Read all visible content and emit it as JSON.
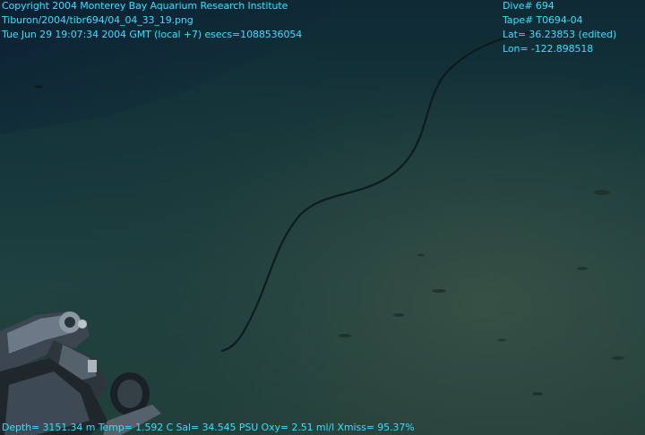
{
  "overlay": {
    "top_left": {
      "copyright": "Copyright 2004 Monterey Bay Aquarium Research Institute",
      "file": "Tiburon/2004/tibr694/04_04_33_19.png",
      "time": "Tue Jun 29 19:07:34 2004 GMT (local +7)  esecs=1088536054"
    },
    "top_right": {
      "dive": "Dive# 694",
      "tape": "Tape# T0694-04",
      "lat": "Lat= 36.23853 (edited)",
      "lon": "Lon= -122.898518"
    },
    "bottom": {
      "sensors": "Depth= 3151.34 m  Temp= 1.592 C  Sal= 34.545 PSU  Oxy= 2.51 ml/l  Xmiss= 95.37%"
    }
  },
  "colors": {
    "overlay_text": "#33e0ff",
    "water_dark": "#0f2a35",
    "sediment": "#3a5246"
  },
  "icons": {
    "manipulator": "rov-manipulator-arm"
  }
}
